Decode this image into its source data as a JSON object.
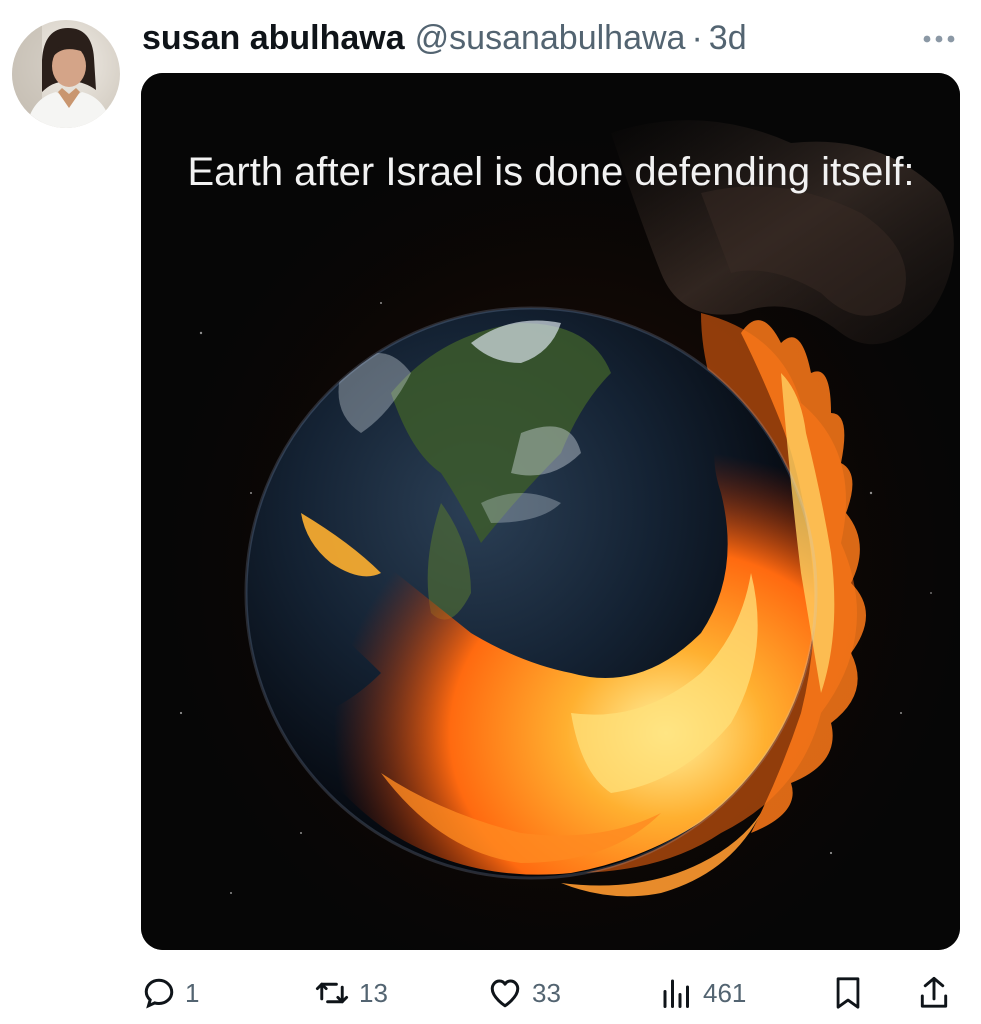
{
  "tweet": {
    "author": {
      "display_name": "susan abulhawa",
      "handle": "@susanabulhawa",
      "avatar_icon": "profile-photo"
    },
    "separator": "·",
    "time": "3d",
    "more_icon": "more-horizontal-icon",
    "media": {
      "caption": "Earth after Israel is done defending itself:"
    },
    "actions": {
      "replies": "1",
      "reposts": "13",
      "likes": "33",
      "views": "461"
    }
  },
  "colors": {
    "text_primary": "#0f1419",
    "text_secondary": "#536471",
    "fire": "#ff7a1a"
  }
}
